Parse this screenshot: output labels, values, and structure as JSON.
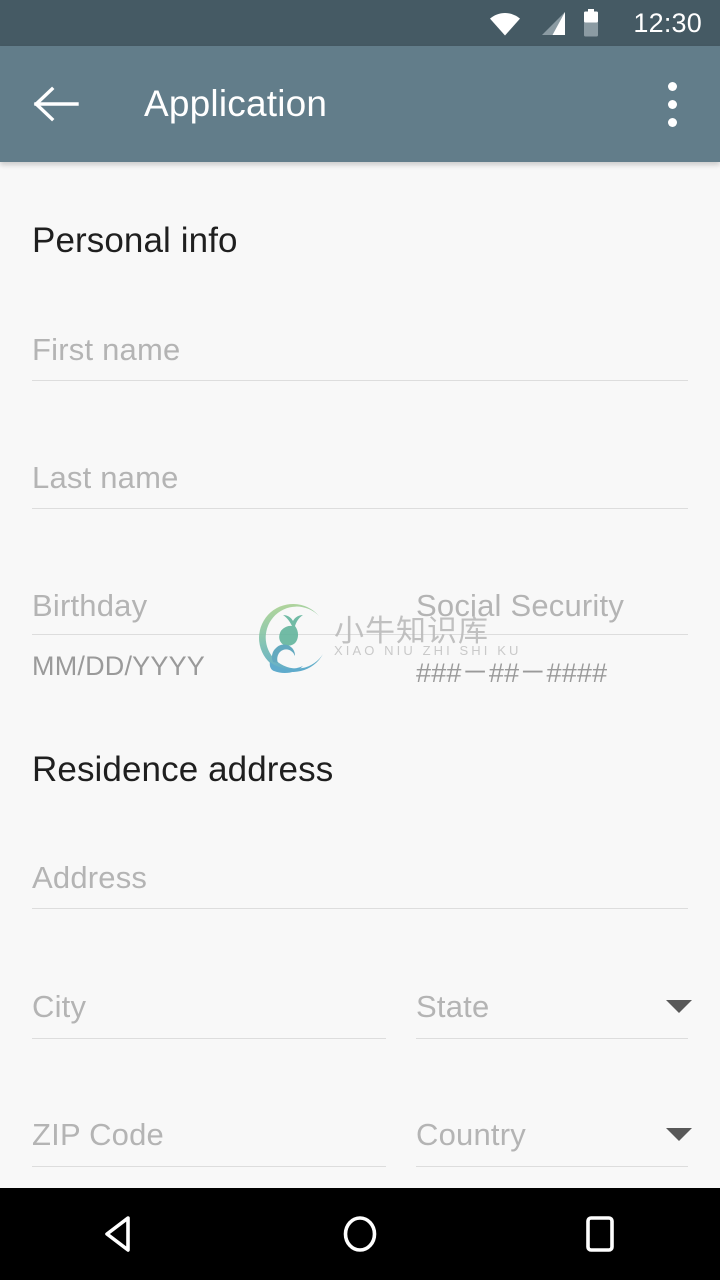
{
  "status_bar": {
    "clock": "12:30",
    "icons": [
      "wifi-icon",
      "cell-signal-icon",
      "battery-icon"
    ],
    "background": "#455a64"
  },
  "app_bar": {
    "title": "Application",
    "back_icon": "back-arrow-icon",
    "overflow_icon": "overflow-menu-icon",
    "background": "#627d8a",
    "text_color": "#ffffff"
  },
  "form": {
    "sections": [
      {
        "heading": "Personal info",
        "fields": [
          {
            "name": "first-name",
            "placeholder": "First name",
            "type": "text",
            "helper": ""
          },
          {
            "name": "last-name",
            "placeholder": "Last name",
            "type": "text",
            "helper": ""
          },
          {
            "name": "birthday",
            "placeholder": "Birthday",
            "type": "text",
            "helper": "MM/DD/YYYY"
          },
          {
            "name": "social-security",
            "placeholder": "Social Security",
            "type": "text",
            "helper": "###－##－####"
          }
        ]
      },
      {
        "heading": "Residence address",
        "fields": [
          {
            "name": "address",
            "placeholder": "Address",
            "type": "text",
            "helper": ""
          },
          {
            "name": "city",
            "placeholder": "City",
            "type": "text",
            "helper": ""
          },
          {
            "name": "state",
            "placeholder": "State",
            "type": "dropdown",
            "helper": ""
          },
          {
            "name": "zip-code",
            "placeholder": "ZIP Code",
            "type": "text",
            "helper": ""
          },
          {
            "name": "country",
            "placeholder": "Country",
            "type": "dropdown",
            "helper": ""
          }
        ]
      }
    ],
    "placeholder_color": "#b4b4b4",
    "helper_color": "#9a9a9a",
    "underline_color": "#dddddd",
    "heading_color": "#1f1f1f",
    "background": "#f8f8f8"
  },
  "watermark": {
    "chinese": "小牛知识库",
    "pinyin": "XIAO NIU ZHI SHI KU",
    "logo_name": "deer-circle-logo",
    "gradient_start": "#9ecb8a",
    "gradient_end": "#4fa3c7"
  },
  "nav_bar": {
    "background": "#000000",
    "buttons": [
      {
        "name": "nav-back",
        "icon": "back-triangle-icon"
      },
      {
        "name": "nav-home",
        "icon": "home-circle-icon"
      },
      {
        "name": "nav-recents",
        "icon": "recents-square-icon"
      }
    ]
  }
}
